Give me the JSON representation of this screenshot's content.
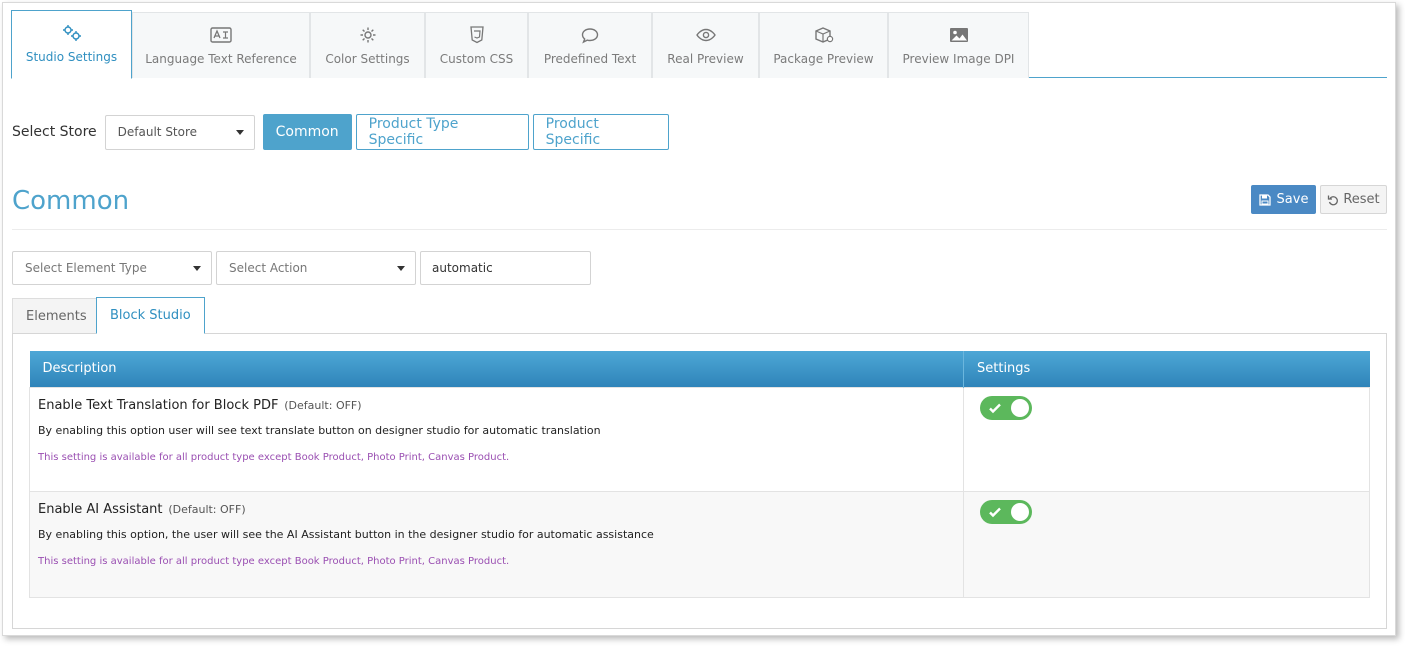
{
  "top_tabs": [
    {
      "label": "Studio Settings",
      "icon": "gears-icon",
      "active": true
    },
    {
      "label": "Language Text Reference",
      "icon": "language-card-icon",
      "active": false
    },
    {
      "label": "Color Settings",
      "icon": "gear-icon",
      "active": false
    },
    {
      "label": "Custom CSS",
      "icon": "css3-icon",
      "active": false
    },
    {
      "label": "Predefined Text",
      "icon": "speech-bubble-icon",
      "active": false
    },
    {
      "label": "Real Preview",
      "icon": "eye-icon",
      "active": false
    },
    {
      "label": "Package Preview",
      "icon": "package-icon",
      "active": false
    },
    {
      "label": "Preview Image DPI",
      "icon": "image-icon",
      "active": false
    }
  ],
  "store": {
    "label": "Select Store",
    "selected": "Default Store"
  },
  "scope_buttons": [
    {
      "label": "Common",
      "active": true
    },
    {
      "label": "Product Type Specific",
      "active": false
    },
    {
      "label": "Product Specific",
      "active": false
    }
  ],
  "section": {
    "title": "Common",
    "save_label": "Save",
    "reset_label": "Reset"
  },
  "filters": {
    "element_type_placeholder": "Select Element Type",
    "action_placeholder": "Select Action",
    "search_value": "automatic"
  },
  "inner_tabs": [
    {
      "label": "Elements",
      "active": false
    },
    {
      "label": "Block Studio",
      "active": true
    }
  ],
  "table": {
    "headers": {
      "description": "Description",
      "settings": "Settings"
    },
    "rows": [
      {
        "title": "Enable Text Translation for Block PDF",
        "default": "(Default: OFF)",
        "description": "By enabling this option user will see text translate button on designer studio for automatic translation",
        "note": "This setting is available for all product type except Book Product, Photo Print, Canvas Product.",
        "enabled": true
      },
      {
        "title": "Enable AI Assistant",
        "default": "(Default: OFF)",
        "description": "By enabling this option, the user will see the AI Assistant button in the designer studio for automatic assistance",
        "note": "This setting is available for all product type except Book Product, Photo Print, Canvas Product.",
        "enabled": true
      }
    ]
  },
  "colors": {
    "accent": "#4ea3cc",
    "save_button": "#4a89c4",
    "toggle_on": "#5cb85c",
    "note_text": "#9a4fb2"
  }
}
